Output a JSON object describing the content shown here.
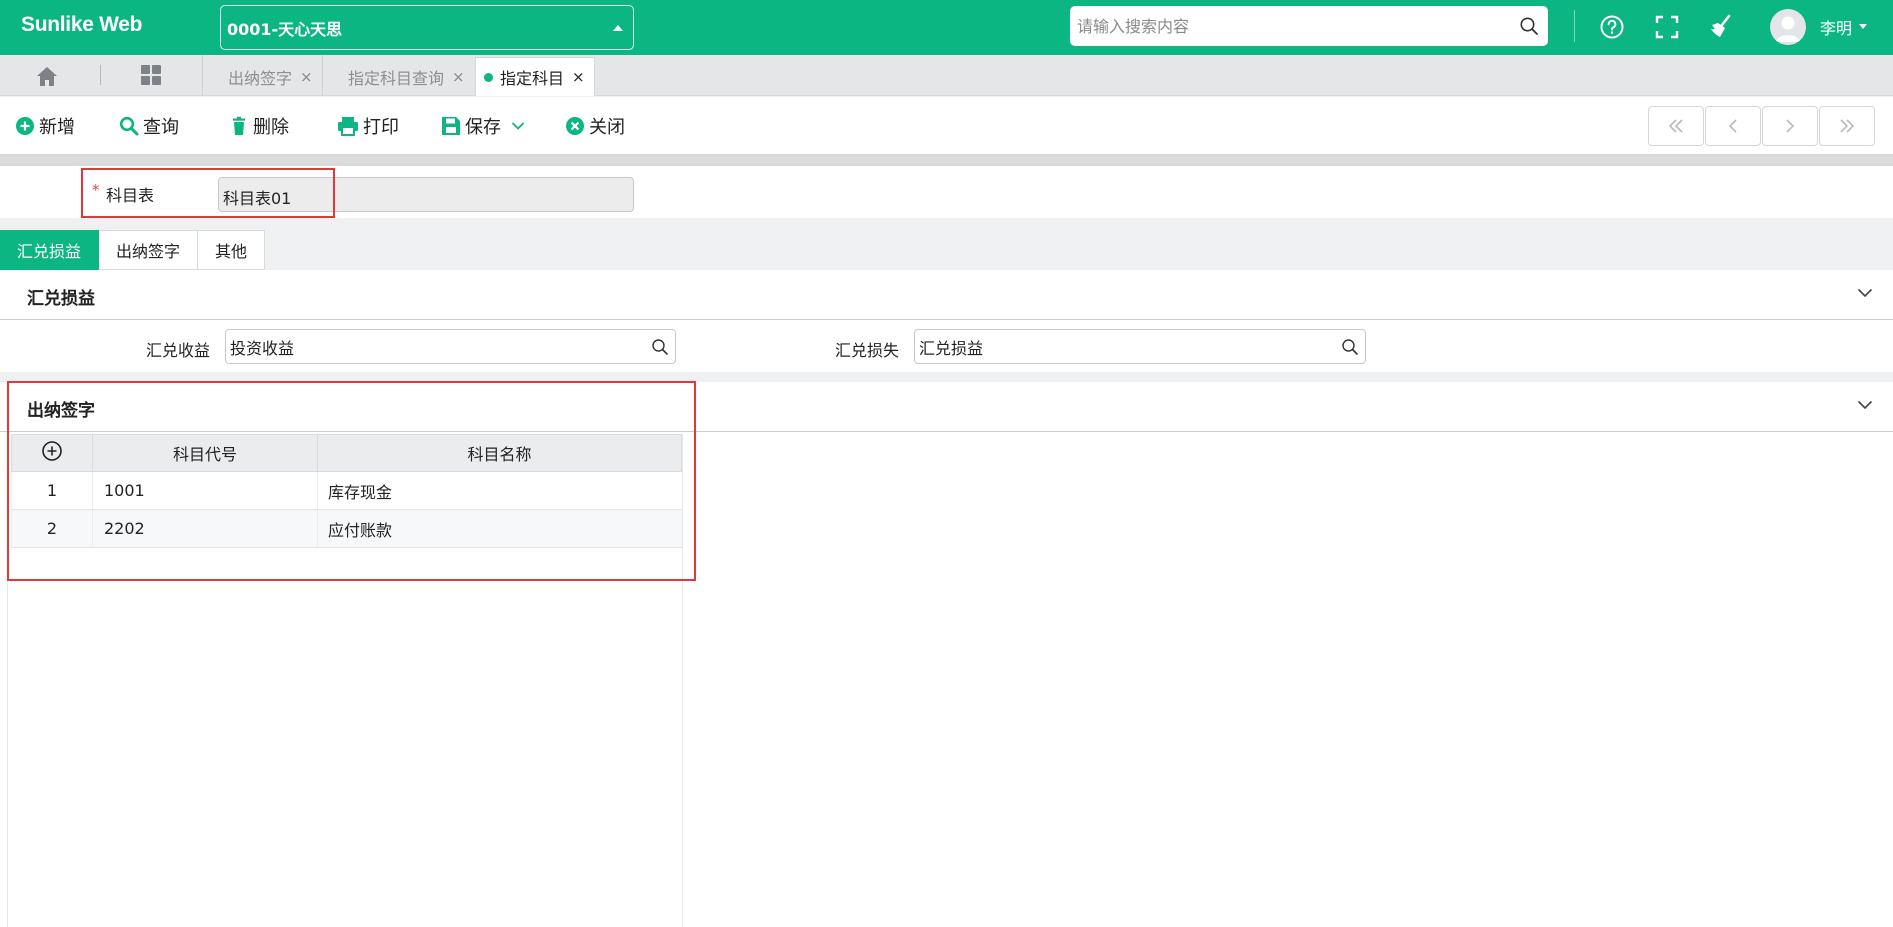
{
  "app": {
    "brand": "Sunlike Web"
  },
  "header": {
    "org_selector": "0001-天心天思",
    "search_placeholder": "请输入搜索内容",
    "user_name": "李明"
  },
  "tabs": {
    "open": [
      {
        "label": "出纳签字",
        "active": false
      },
      {
        "label": "指定科目查询",
        "active": false
      },
      {
        "label": "指定科目",
        "active": true
      }
    ],
    "close_glyph": "×"
  },
  "toolbar": {
    "add": "新增",
    "query": "查询",
    "delete": "删除",
    "print": "打印",
    "save": "保存",
    "close": "关闭"
  },
  "form": {
    "required_mark": "*",
    "chart_label": "科目表",
    "chart_value": "科目表01"
  },
  "subtabs": [
    {
      "label": "汇兑损益",
      "active": true
    },
    {
      "label": "出纳签字",
      "active": false
    },
    {
      "label": "其他",
      "active": false
    }
  ],
  "section_fx": {
    "title": "汇兑损益",
    "gain_label": "汇兑收益",
    "gain_value": "投资收益",
    "loss_label": "汇兑损失",
    "loss_value": "汇兑损益"
  },
  "section_cashier": {
    "title": "出纳签字",
    "columns": [
      "科目代号",
      "科目名称"
    ],
    "rows": [
      {
        "no": "1",
        "code": "1001",
        "name": "库存现金"
      },
      {
        "no": "2",
        "code": "2202",
        "name": "应付账款"
      }
    ]
  },
  "colors": {
    "brand_green": "#0bb683",
    "highlight_red": "#e2383a"
  }
}
